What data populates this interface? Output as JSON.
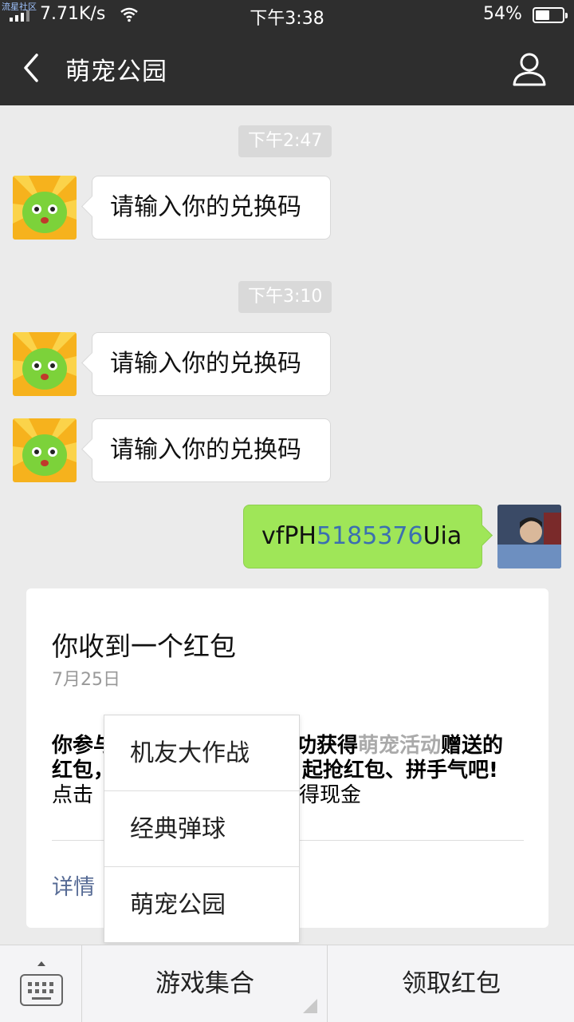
{
  "status_bar": {
    "watermark": "流星社区",
    "net_speed": "7.71K/s",
    "time": "下午3:38",
    "battery_pct": "54%",
    "battery_level": 0.54
  },
  "header": {
    "title": "萌宠公园",
    "back_icon": "chevron-left-icon",
    "profile_icon": "person-icon"
  },
  "messages": {
    "ts1": "下午2:47",
    "msg1": "请输入你的兑换码",
    "ts2": "下午3:10",
    "msg2": "请输入你的兑换码",
    "msg3": "请输入你的兑换码",
    "sent_prefix": "vfPH",
    "sent_digits": "5185376",
    "sent_suffix": "Uia"
  },
  "card": {
    "title": "你收到一个红包",
    "date": "7月25日",
    "body_line1_pre": "你参与",
    "body_line1_post": "功获得",
    "body_highlight": "萌宠活动",
    "body_line1_end": "赠送的",
    "body_line2_pre": "红包，",
    "body_line2_post": "起抢红包、拼手气吧!",
    "body_line3_pre": "点击",
    "body_line3_post": "得现金",
    "detail": "详情"
  },
  "popup_menu": {
    "items": [
      "机友大作战",
      "经典弹球",
      "萌宠公园"
    ]
  },
  "bottom_bar": {
    "keyboard_icon": "keyboard-icon",
    "games_label": "游戏集合",
    "redpack_label": "领取红包"
  },
  "colors": {
    "header_bg": "#2e2e2e",
    "chat_bg": "#ebebeb",
    "sent_bubble": "#9fe658",
    "link": "#576b95"
  }
}
